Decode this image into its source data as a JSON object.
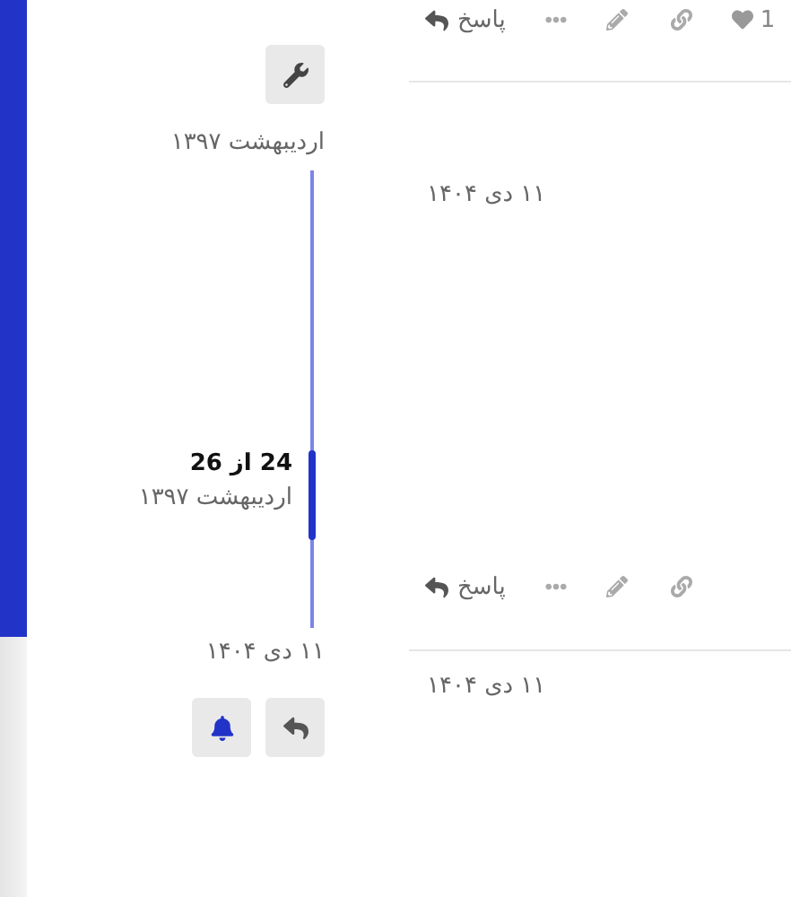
{
  "timeline": {
    "start_date": "اردیبهشت ۱۳۹۷",
    "position": "24 از 26",
    "position_date": "اردیبهشت ۱۳۹۷",
    "level": 0.76,
    "end_date": "۱۱ دی ۱۴۰۴"
  },
  "posts": [
    {
      "actions": {
        "reply": "پاسخ",
        "like_count": "1"
      }
    },
    {
      "date": "۱۱ دی ۱۴۰۴",
      "actions": {
        "reply": "پاسخ"
      }
    },
    {
      "date": "۱۱ دی ۱۴۰۴"
    }
  ]
}
